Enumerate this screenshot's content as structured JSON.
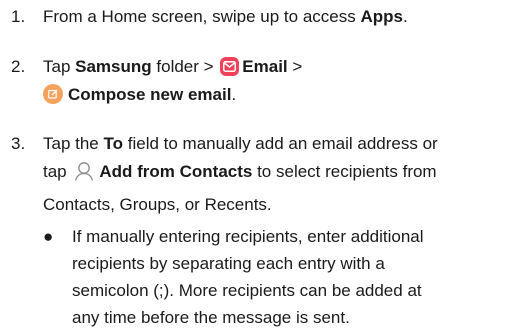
{
  "steps": [
    {
      "number": "1.",
      "parts": [
        "From a Home screen, swipe up to access ",
        "Apps",
        "."
      ]
    },
    {
      "number": "2.",
      "parts": [
        "Tap ",
        "Samsung",
        " folder > ",
        "Email",
        " >",
        "Compose new email",
        "."
      ]
    },
    {
      "number": "3.",
      "lines": [
        [
          "Tap the ",
          "To",
          " field to manually add an email address or"
        ],
        [
          "tap ",
          "Add from Contacts",
          " to select recipients from"
        ],
        [
          "Contacts, Groups, or Recents."
        ]
      ]
    }
  ],
  "bullet": {
    "symbol": "●",
    "lines": [
      "If manually entering recipients, enter additional",
      "recipients by separating each entry with a",
      "semicolon (;). More recipients can be added at",
      "any time before the message is sent."
    ]
  },
  "icons": {
    "email": "email-app-icon",
    "compose": "compose-icon",
    "contacts": "person-outline-icon"
  },
  "colors": {
    "email_icon": "#f0405a",
    "compose_icon": "#f5a25c",
    "text": "#1a1a1a"
  }
}
